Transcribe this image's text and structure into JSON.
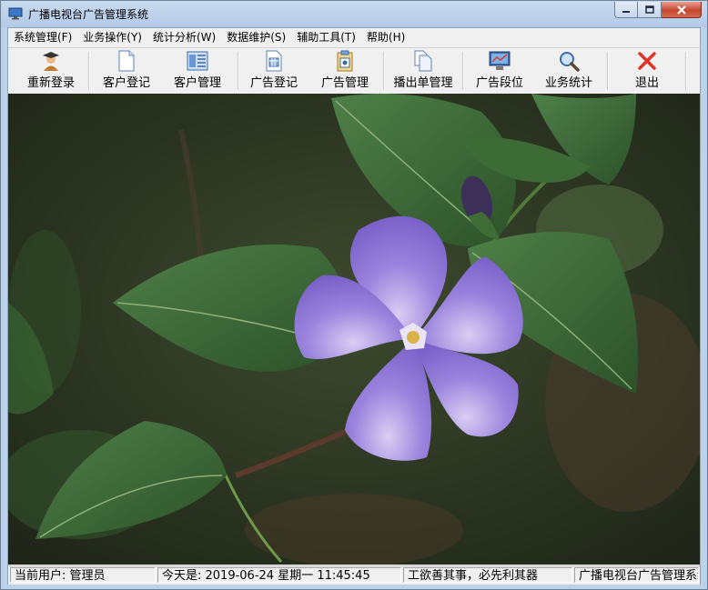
{
  "window": {
    "title": "广播电视台广告管理系统"
  },
  "menu": [
    {
      "label": "系统管理(F)"
    },
    {
      "label": "业务操作(Y)"
    },
    {
      "label": "统计分析(W)"
    },
    {
      "label": "数据维护(S)"
    },
    {
      "label": "辅助工具(T)"
    },
    {
      "label": "帮助(H)"
    }
  ],
  "toolbar": [
    {
      "label": "重新登录",
      "icon": "graduate-user-icon"
    },
    {
      "label": "客户登记",
      "icon": "blank-document-icon"
    },
    {
      "label": "客户管理",
      "icon": "card-list-icon"
    },
    {
      "label": "广告登记",
      "icon": "calendar-document-icon"
    },
    {
      "label": "广告管理",
      "icon": "clipboard-icon"
    },
    {
      "label": "播出单管理",
      "icon": "copy-documents-icon"
    },
    {
      "label": "广告段位",
      "icon": "monitor-icon"
    },
    {
      "label": "业务统计",
      "icon": "magnifier-icon"
    },
    {
      "label": "退出",
      "icon": "red-x-icon"
    }
  ],
  "status": {
    "user": "当前用户: 管理员",
    "date": "今天是: 2019-06-24 星期一 11:45:45",
    "motto": "工欲善其事，必先利其器",
    "app": "广播电视台广告管理系统"
  },
  "colors": {
    "title_bg": "#bcd1ea",
    "close_red": "#c8452f",
    "flower": "#8a6fcf",
    "leaf": "#3f6b3a"
  }
}
